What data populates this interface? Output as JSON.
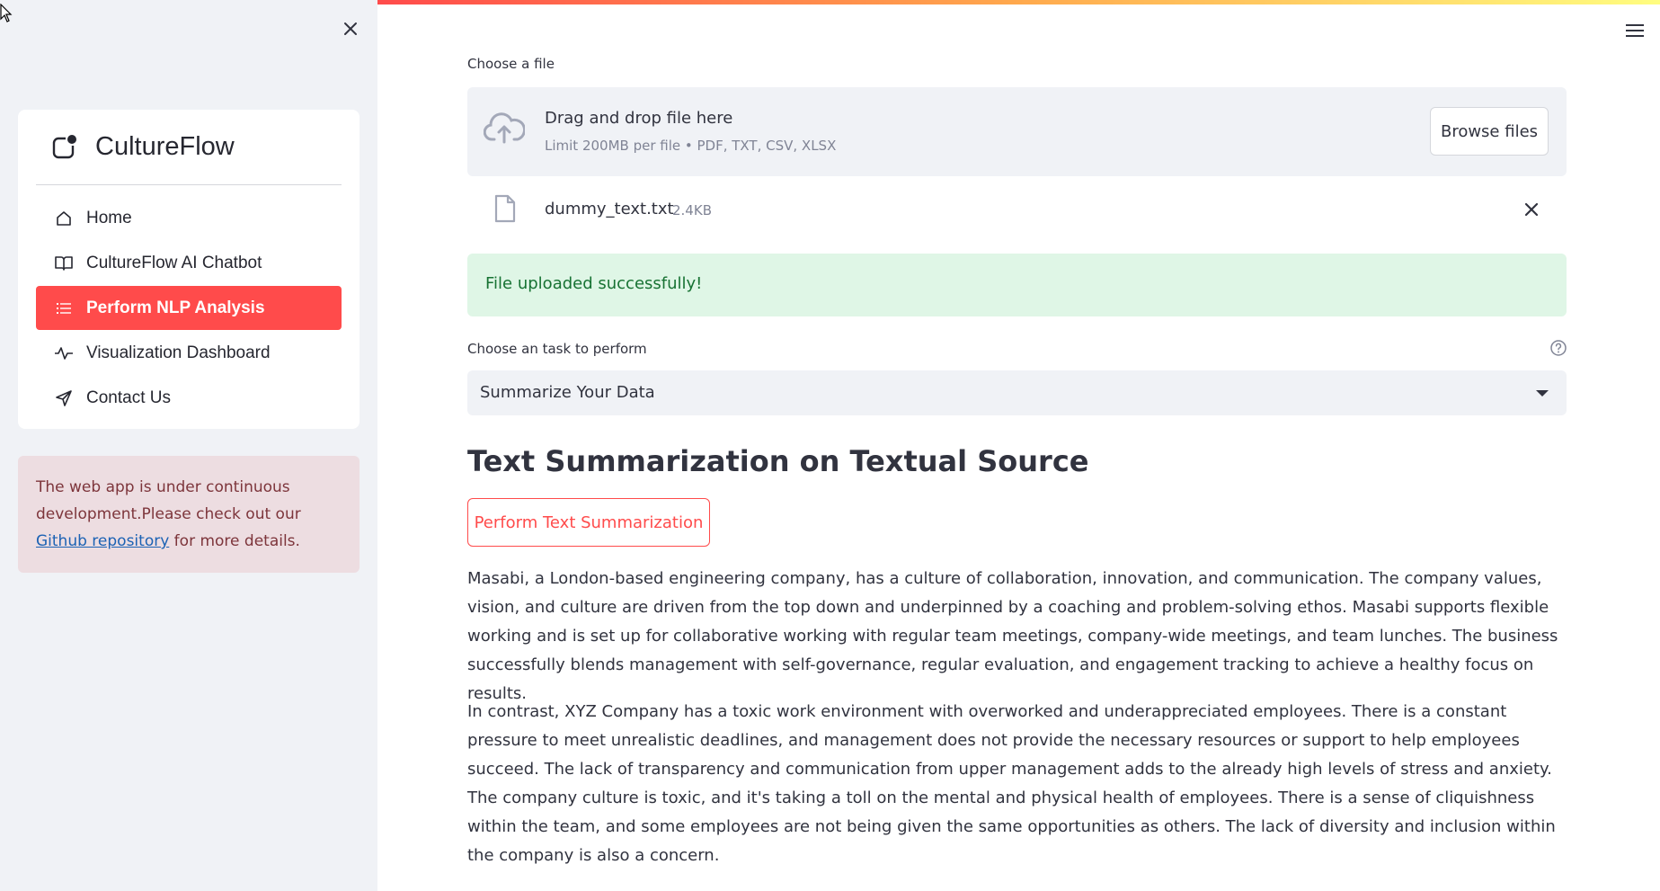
{
  "sidebar": {
    "brand": "CultureFlow",
    "close_icon": "close-icon",
    "items": [
      {
        "label": "Home",
        "icon": "home-icon",
        "active": false
      },
      {
        "label": "CultureFlow AI Chatbot",
        "icon": "book-icon",
        "active": false
      },
      {
        "label": "Perform NLP Analysis",
        "icon": "list-icon",
        "active": true
      },
      {
        "label": "Visualization Dashboard",
        "icon": "activity-icon",
        "active": false
      },
      {
        "label": "Contact Us",
        "icon": "send-icon",
        "active": false
      }
    ],
    "notice": {
      "text_before": "The web app is under continuous development.Please check out our ",
      "link": "Github repository",
      "text_after": " for more details."
    }
  },
  "uploader": {
    "label": "Choose a file",
    "drop_title": "Drag and drop file here",
    "drop_limit": "Limit 200MB per file • PDF, TXT, CSV, XLSX",
    "browse_label": "Browse files",
    "file": {
      "name": "dummy_text.txt",
      "size": "2.4KB"
    }
  },
  "status": {
    "success": "File uploaded successfully!"
  },
  "task": {
    "label": "Choose an task to perform",
    "selected": "Summarize Your Data"
  },
  "section": {
    "title": "Text Summarization on Textual Source",
    "button": "Perform Text Summarization"
  },
  "content": {
    "paragraph_1": "Masabi, a London-based engineering company, has a culture of collaboration, innovation, and communication. The company values, vision, and culture are driven from the top down and underpinned by a coaching and problem-solving ethos. Masabi supports flexible working and is set up for collaborative working with regular team meetings, company-wide meetings, and team lunches. The business successfully blends management with self-governance, regular evaluation, and engagement tracking to achieve a healthy focus on results.",
    "paragraph_2": "In contrast, XYZ Company has a toxic work environment with overworked and underappreciated employees. There is a constant pressure to meet unrealistic deadlines, and management does not provide the necessary resources or support to help employees succeed. The lack of transparency and communication from upper management adds to the already high levels of stress and anxiety. The company culture is toxic, and it's taking a toll on the mental and physical health of employees. There is a sense of cliquishness within the team, and some employees are not being given the same opportunities as others. The lack of diversity and inclusion within the company is also a concern."
  },
  "colors": {
    "accent": "#ff4b4b",
    "success_bg": "#dff6e6",
    "success_text": "#177233",
    "sidebar_bg": "#f0f2f6",
    "notice_bg": "#eddde1"
  }
}
